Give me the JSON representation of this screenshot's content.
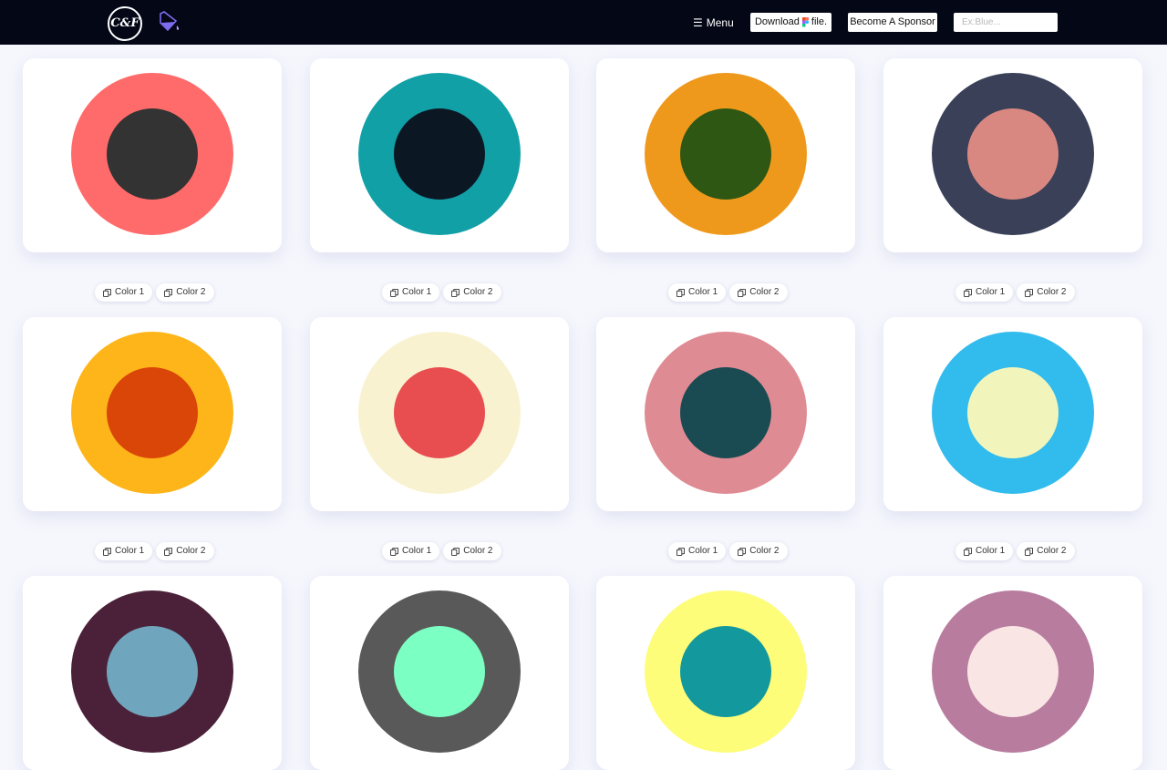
{
  "header": {
    "logo_text": "C&F",
    "menu_label": "Menu",
    "download_label": "Download",
    "download_suffix": "file.",
    "sponsor_label": "Become A Sponsor",
    "search_placeholder": "Ex:Blue...",
    "search_value": ""
  },
  "copy_labels": {
    "color1": "Color 1",
    "color2": "Color 2"
  },
  "palettes": [
    {
      "outer": "#ff6b6b",
      "inner": "#333333"
    },
    {
      "outer": "#12a0a7",
      "inner": "#0b1824"
    },
    {
      "outer": "#ef991c",
      "inner": "#2d5713"
    },
    {
      "outer": "#394058",
      "inner": "#d98881"
    },
    {
      "outer": "#fdb51a",
      "inner": "#da4508"
    },
    {
      "outer": "#f9f2d0",
      "inner": "#e84d4f"
    },
    {
      "outer": "#df8b93",
      "inner": "#1a4b52"
    },
    {
      "outer": "#32bbed",
      "inner": "#f1f5bb"
    },
    {
      "outer": "#4b213a",
      "inner": "#70a6bd"
    },
    {
      "outer": "#595959",
      "inner": "#7cffc2"
    },
    {
      "outer": "#fdfd7a",
      "inner": "#13989d"
    },
    {
      "outer": "#b87c9f",
      "inner": "#fae5e5"
    }
  ]
}
